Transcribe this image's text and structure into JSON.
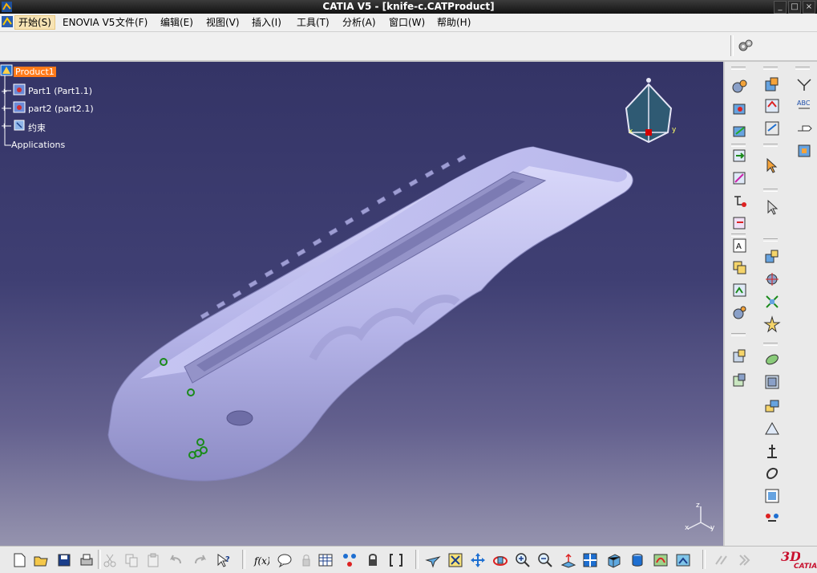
{
  "window": {
    "title": "CATIA V5 - [knife-c.CATProduct]"
  },
  "menubar": {
    "items": [
      "开始(S)",
      "ENOVIA V5",
      "文件(F)",
      "编辑(E)",
      "视图(V)",
      "插入(I)",
      "工具(T)",
      "分析(A)",
      "窗口(W)",
      "帮助(H)"
    ]
  },
  "tree": {
    "root": "Product1",
    "children": [
      "Part1 (Part1.1)",
      "part2 (part2.1)",
      "约束"
    ],
    "applications": "Applications"
  },
  "compass": {
    "x": "x",
    "y": "y",
    "z": "z"
  },
  "logo": {
    "text": "CATIA"
  },
  "colors": {
    "selection": "#ff7a1a",
    "part_body": "#b7b6ea",
    "background_top": "#343466",
    "background_bottom": "#9593ae"
  }
}
